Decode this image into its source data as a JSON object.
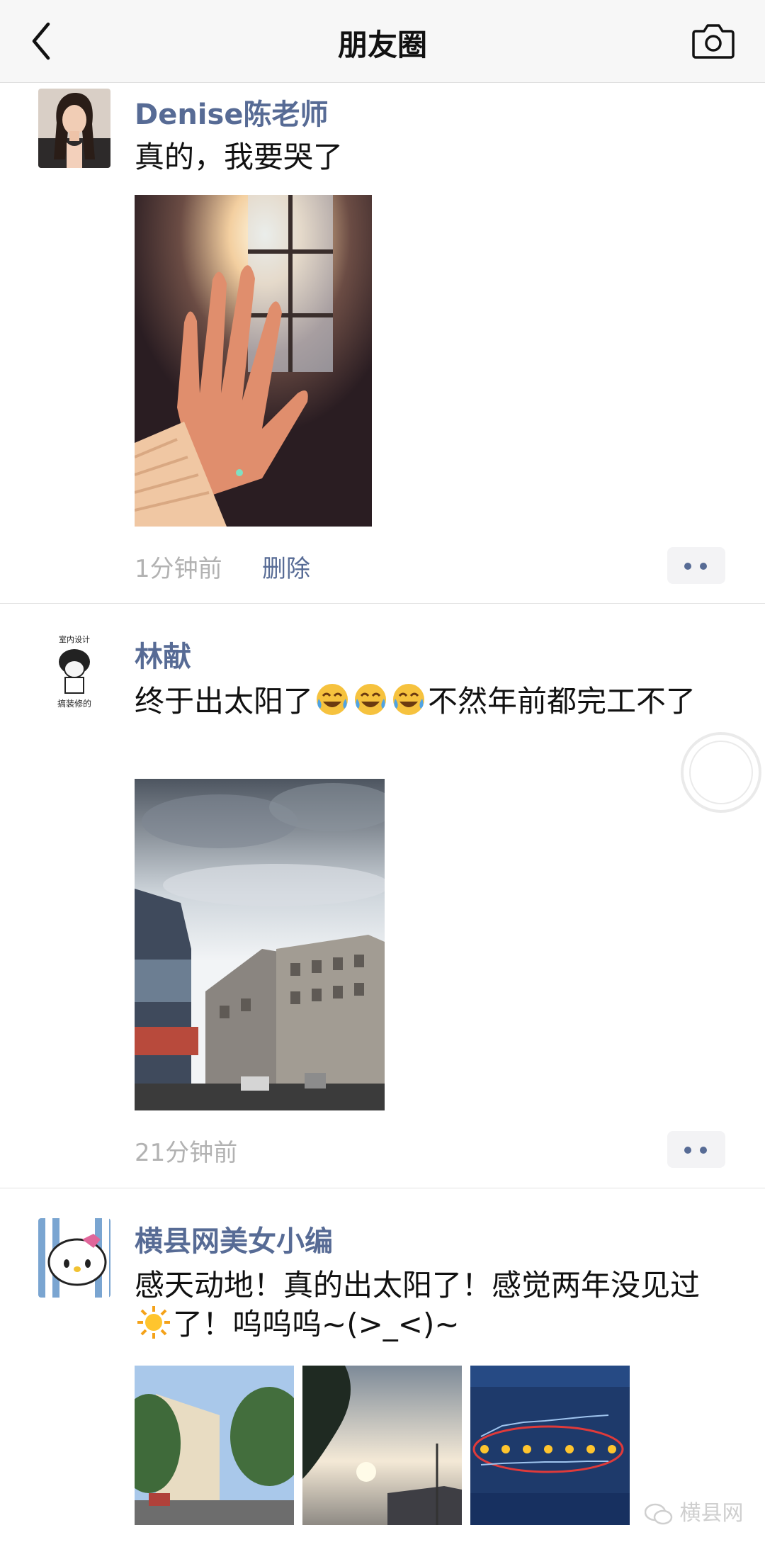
{
  "navbar": {
    "back_icon": "chevron-left-icon",
    "title": "朋友圈",
    "camera_icon": "camera-icon"
  },
  "posts": [
    {
      "nickname": "Denise陈老师",
      "text": "真的，我要哭了",
      "time": "1分钟前",
      "delete_label": "删除",
      "more_icon": "more-dots-icon"
    },
    {
      "nickname": "林献",
      "text_before": "终于出太阳了",
      "emoji_name": "crying-laughing-emoji",
      "text_after": "不然年前都完工不了",
      "avatar_text_top": "室内设计",
      "avatar_text_bottom": "搞装修的",
      "time": "21分钟前",
      "more_icon": "more-dots-icon"
    },
    {
      "nickname": "横县网美女小编",
      "text_part1": "感天动地！真的出太阳了！感觉两年没见过",
      "emoji_name": "sun-emoji",
      "text_part2": "了！呜呜呜~(>_<)~"
    }
  ],
  "watermark": {
    "text": "横县网"
  },
  "colors": {
    "link": "#576b95",
    "time": "#b2b2b2",
    "navbar_bg": "#f7f7f7"
  }
}
